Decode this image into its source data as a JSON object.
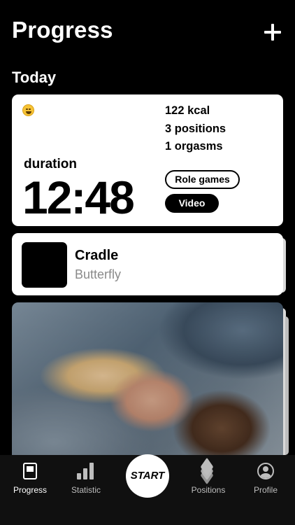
{
  "header": {
    "title": "Progress"
  },
  "section": {
    "title": "Today"
  },
  "summary": {
    "kcal": "122 kcal",
    "positions": "3 positions",
    "orgasms": "1 orgasms",
    "duration_label": "duration",
    "duration_value": "12:48",
    "tags": [
      "Role games",
      "Video"
    ]
  },
  "position_card": {
    "title": "Cradle",
    "subtitle": "Butterfly"
  },
  "tabbar": {
    "items": [
      {
        "label": "Progress",
        "icon": "progress-icon",
        "active": true
      },
      {
        "label": "Statistic",
        "icon": "statistic-icon"
      },
      {
        "label": "Positions",
        "icon": "positions-icon"
      },
      {
        "label": "Profile",
        "icon": "profile-icon"
      }
    ],
    "start_label": "START"
  }
}
